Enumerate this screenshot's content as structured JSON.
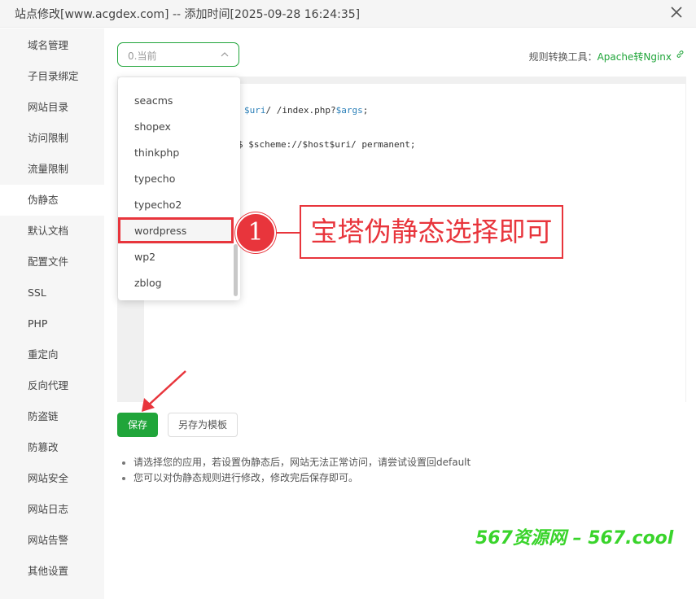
{
  "window": {
    "title": "站点修改[www.acgdex.com] -- 添加时间[2025-09-28 16:24:35]"
  },
  "sidebar": {
    "items": [
      "域名管理",
      "子目录绑定",
      "网站目录",
      "访问限制",
      "流量限制",
      "伪静态",
      "默认文档",
      "配置文件",
      "SSL",
      "PHP",
      "重定向",
      "反向代理",
      "防盗链",
      "防篡改",
      "网站安全",
      "网站日志",
      "网站告警",
      "其他设置"
    ],
    "active": "伪静态"
  },
  "rewrite": {
    "select_value": "0.当前",
    "tool_label": "规则转换工具：",
    "tool_link": "Apache转Nginx",
    "options": [
      "seacms",
      "shopex",
      "thinkphp",
      "typecho",
      "typecho2",
      "wordpress",
      "wp2",
      "zblog"
    ],
    "highlighted_option": "wordpress",
    "code": {
      "line1_var1": "$uri",
      "line1_mid": "/ /index.php?",
      "line1_var2": "$args",
      "line1_end": ";",
      "line2": "$ $scheme://$host$uri/ permanent;"
    },
    "save_label": "保存",
    "template_label": "另存为模板",
    "notes": [
      "请选择您的应用，若设置伪静态后，网站无法正常访问，请尝试设置回default",
      "您可以对伪静态规则进行修改，修改完后保存即可。"
    ]
  },
  "annotation": {
    "step": "1",
    "callout": "宝塔伪静态选择即可",
    "color": "#e8353c"
  },
  "watermark": "567资源网 – 567.cool",
  "colors": {
    "accent": "#20a53a",
    "annotation": "#e8353c",
    "watermark": "#39d42b"
  }
}
